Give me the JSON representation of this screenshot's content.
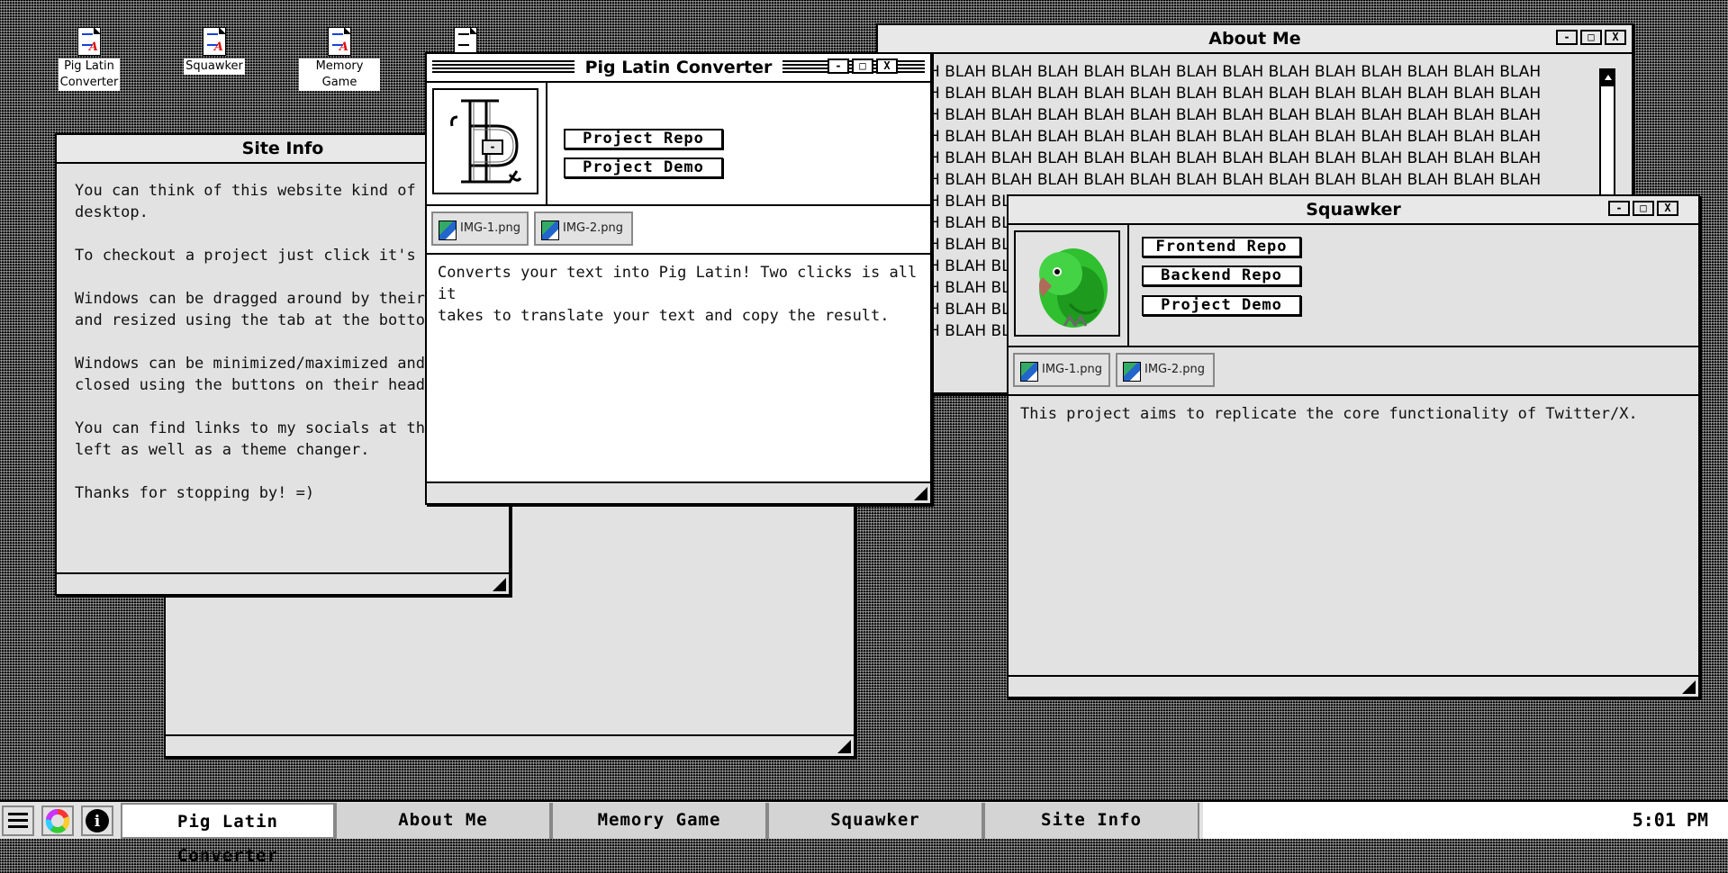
{
  "desktop": {
    "icons": [
      {
        "label_line1": "Pig Latin",
        "label_line2": "Converter"
      },
      {
        "label": "Squawker"
      },
      {
        "label": "Memory Game"
      }
    ]
  },
  "windows": {
    "site_info": {
      "title": "Site Info",
      "paragraphs": [
        "You can think of this website kind of like y",
        "desktop.",
        "To checkout a project just click it's icon.",
        "Windows can be dragged around by their he",
        "and resized using the tab at the bottom rig",
        "Windows can be minimized/maximized and",
        "closed using the buttons on their headers.",
        "You can find links to my socials at the bott",
        "left as well as a theme changer.",
        "Thanks for stopping by!  =)"
      ]
    },
    "pig_latin": {
      "title": "Pig Latin Converter",
      "buttons": {
        "repo": "Project Repo",
        "demo": "Project Demo"
      },
      "files": [
        "IMG-1.png",
        "IMG-2.png"
      ],
      "description_line1": "Converts your text into Pig Latin! Two clicks is all it",
      "description_line2": "takes to translate your text and copy the result."
    },
    "about_me": {
      "title": "About Me",
      "blah_full": "H BLAH BLAH BLAH BLAH BLAH BLAH BLAH BLAH BLAH BLAH BLAH BLAH BLAH",
      "blah_partial": "H BLAH BL"
    },
    "squawker": {
      "title": "Squawker",
      "buttons": {
        "frontend": "Frontend Repo",
        "backend": "Backend Repo",
        "demo": "Project Demo"
      },
      "files": [
        "IMG-1.png",
        "IMG-2.png"
      ],
      "description": "This project aims to replicate the core functionality of Twitter/X."
    },
    "controls": {
      "minimize": "-",
      "maximize": "□",
      "close": "X"
    }
  },
  "taskbar": {
    "menu_icon": "hamburger-icon",
    "theme_icon": "color-wheel-icon",
    "info_icon": "info-icon",
    "info_glyph": "i",
    "tasks": [
      "Pig Latin Converter",
      "About Me",
      "Memory Game",
      "Squawker",
      "Site Info"
    ],
    "active_task": "Pig Latin Converter",
    "clock": "5:01 PM"
  }
}
